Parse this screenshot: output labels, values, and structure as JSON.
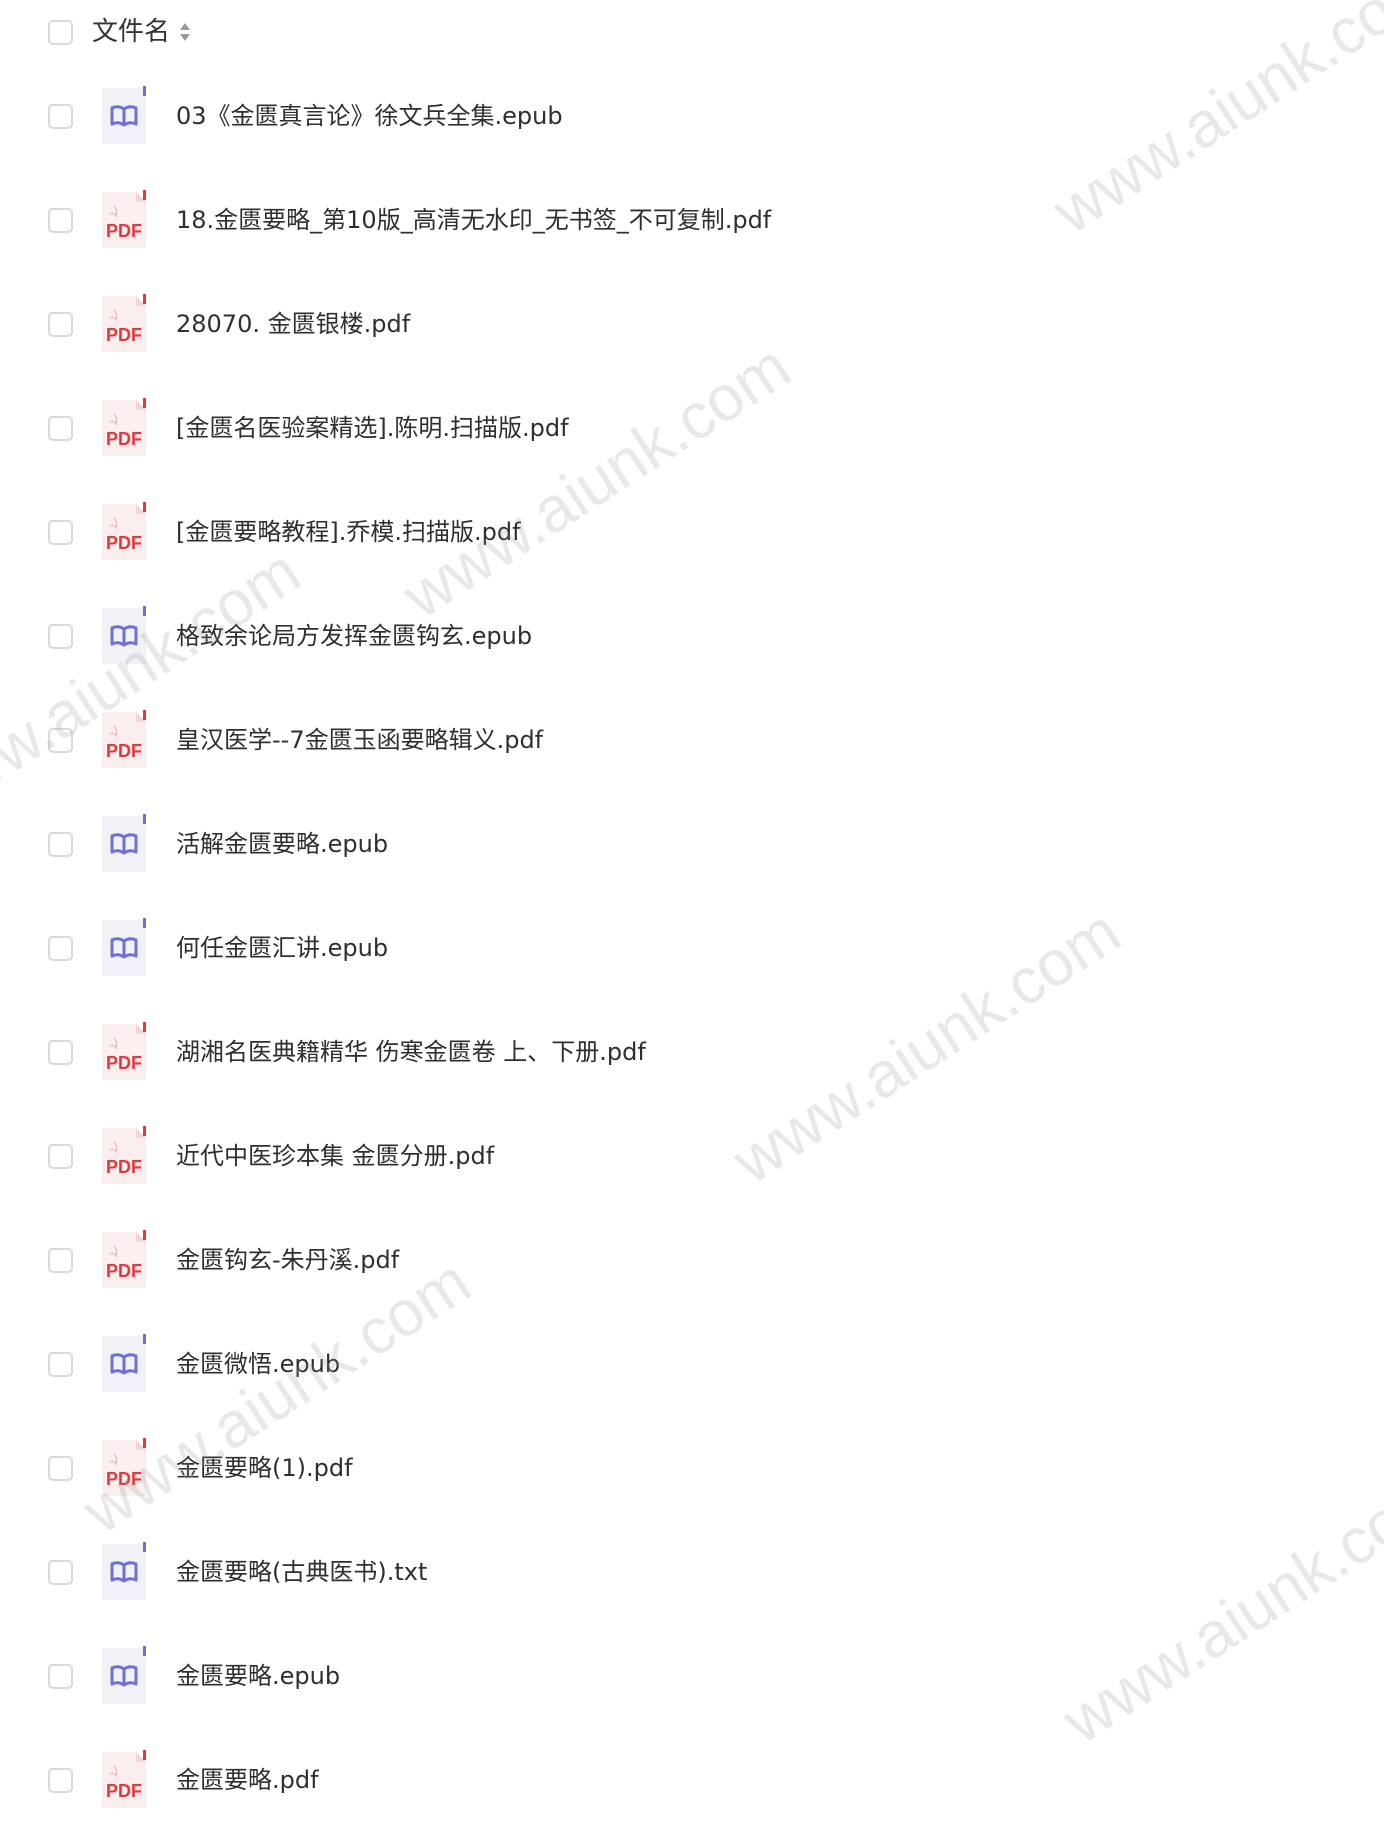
{
  "header": {
    "column_label": "文件名"
  },
  "files": [
    {
      "name": "03《金匮真言论》徐文兵全集.epub",
      "type": "epub"
    },
    {
      "name": "18.金匮要略_第10版_高清无水印_无书签_不可复制.pdf",
      "type": "pdf"
    },
    {
      "name": "28070. 金匮银楼.pdf",
      "type": "pdf"
    },
    {
      "name": "[金匮名医验案精选].陈明.扫描版.pdf",
      "type": "pdf"
    },
    {
      "name": "[金匮要略教程].乔模.扫描版.pdf",
      "type": "pdf"
    },
    {
      "name": "格致余论局方发挥金匮钩玄.epub",
      "type": "epub"
    },
    {
      "name": "皇汉医学--7金匮玉函要略辑义.pdf",
      "type": "pdf"
    },
    {
      "name": "活解金匮要略.epub",
      "type": "epub"
    },
    {
      "name": "何任金匮汇讲.epub",
      "type": "epub"
    },
    {
      "name": "湖湘名医典籍精华 伤寒金匮卷 上、下册.pdf",
      "type": "pdf"
    },
    {
      "name": "近代中医珍本集 金匮分册.pdf",
      "type": "pdf"
    },
    {
      "name": "金匮钩玄-朱丹溪.pdf",
      "type": "pdf"
    },
    {
      "name": "金匮微悟.epub",
      "type": "epub"
    },
    {
      "name": "金匮要略(1).pdf",
      "type": "pdf"
    },
    {
      "name": "金匮要略(古典医书).txt",
      "type": "epub"
    },
    {
      "name": "金匮要略.epub",
      "type": "epub"
    },
    {
      "name": "金匮要略.pdf",
      "type": "pdf"
    }
  ],
  "icon_labels": {
    "pdf": "PDF"
  },
  "watermark": {
    "text": "www.aiunk.com"
  },
  "colors": {
    "pdf_red": "#e0393e",
    "epub_purple": "#6c6fd8",
    "icon_bg": "#f1f1f6",
    "checkbox_border": "#d9d9de"
  }
}
